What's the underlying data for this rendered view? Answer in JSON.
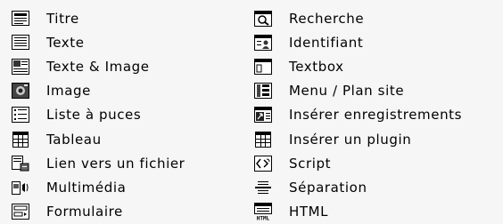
{
  "left_column": [
    {
      "label": "Titre",
      "icon": "title-icon"
    },
    {
      "label": "Texte",
      "icon": "text-icon"
    },
    {
      "label": "Texte & Image",
      "icon": "text-image-icon"
    },
    {
      "label": "Image",
      "icon": "image-icon"
    },
    {
      "label": "Liste à puces",
      "icon": "bullet-list-icon"
    },
    {
      "label": "Tableau",
      "icon": "table-icon"
    },
    {
      "label": "Lien vers un fichier",
      "icon": "file-link-icon"
    },
    {
      "label": "Multimédia",
      "icon": "multimedia-icon"
    },
    {
      "label": "Formulaire",
      "icon": "form-icon"
    }
  ],
  "right_column": [
    {
      "label": "Recherche",
      "icon": "search-icon"
    },
    {
      "label": "Identifiant",
      "icon": "login-icon"
    },
    {
      "label": "Textbox",
      "icon": "textbox-icon"
    },
    {
      "label": "Menu / Plan site",
      "icon": "sitemap-icon"
    },
    {
      "label": "Insérer enregistrements",
      "icon": "insert-records-icon"
    },
    {
      "label": "Insérer un plugin",
      "icon": "plugin-icon"
    },
    {
      "label": "Script",
      "icon": "script-icon"
    },
    {
      "label": "Séparation",
      "icon": "separator-icon"
    },
    {
      "label": "HTML",
      "icon": "html-icon"
    }
  ]
}
